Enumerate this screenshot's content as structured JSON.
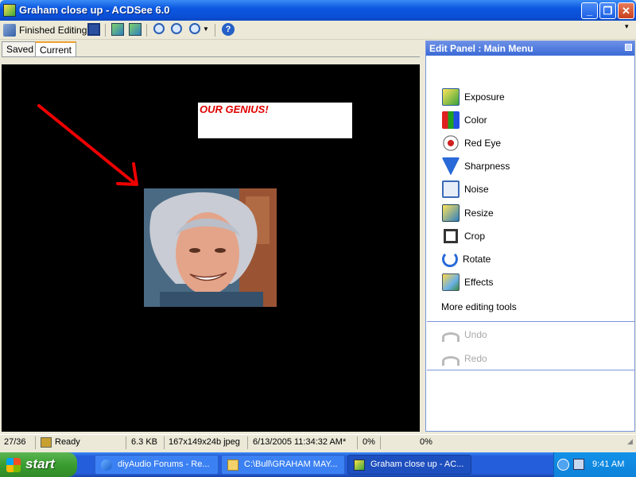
{
  "window": {
    "title": "Graham close up - ACDSee 6.0",
    "minimize": "_",
    "restore": "❐",
    "close": "✕"
  },
  "toolbar": {
    "finished_editing": "Finished Editing"
  },
  "tabs": [
    {
      "label": "Saved"
    },
    {
      "label": "Current"
    }
  ],
  "image": {
    "caption": "OUR GENIUS!"
  },
  "panel": {
    "title": "Edit Panel : Main Menu",
    "tools": [
      {
        "label": "Exposure",
        "icon": "exposure-icon"
      },
      {
        "label": "Color",
        "icon": "color-icon"
      },
      {
        "label": "Red Eye",
        "icon": "red-eye-icon"
      },
      {
        "label": "Sharpness",
        "icon": "sharpness-icon"
      },
      {
        "label": "Noise",
        "icon": "noise-icon"
      },
      {
        "label": "Resize",
        "icon": "resize-icon"
      },
      {
        "label": "Crop",
        "icon": "crop-icon"
      },
      {
        "label": "Rotate",
        "icon": "rotate-icon"
      },
      {
        "label": "Effects",
        "icon": "effects-icon"
      }
    ],
    "more": "More editing tools",
    "undo": "Undo",
    "redo": "Redo"
  },
  "status": {
    "position": "27/36",
    "state": "Ready",
    "size": "6.3 KB",
    "dimensions": "167x149x24b jpeg",
    "date": "6/13/2005 11:34:32 AM*",
    "zoom1": "0%",
    "zoom2": "0%"
  },
  "taskbar": {
    "start": "start",
    "tasks": [
      {
        "label": "diyAudio Forums - Re..."
      },
      {
        "label": "C:\\Bull\\GRAHAM MAY..."
      },
      {
        "label": "Graham close up - AC..."
      }
    ],
    "clock": "9:41 AM"
  }
}
